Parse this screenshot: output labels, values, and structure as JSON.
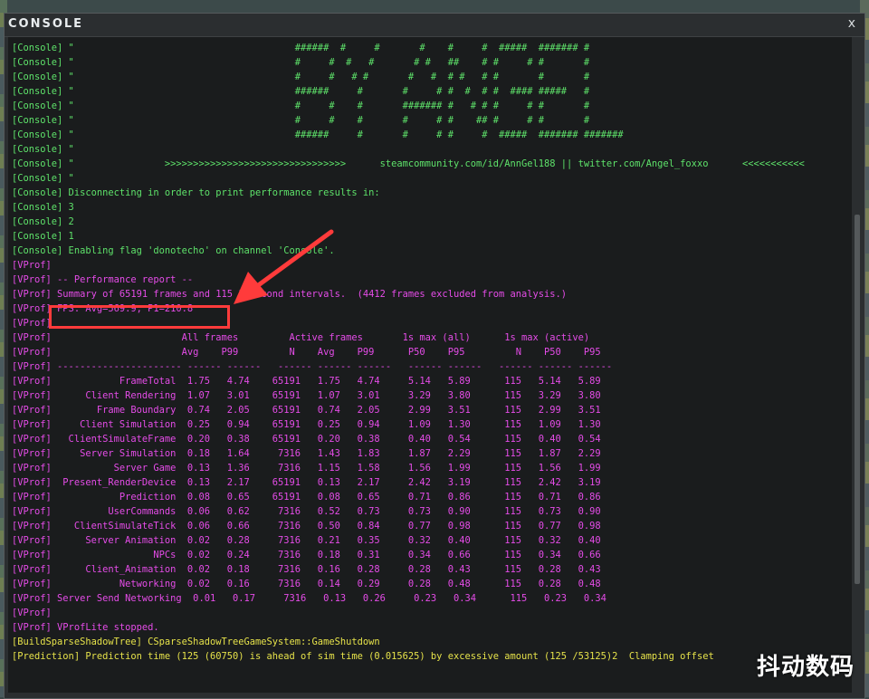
{
  "window": {
    "title": "CONSOLE",
    "close_glyph": "x"
  },
  "lines": [
    {
      "text": "[Console] \"                                       ######  #     #       #    #     #  #####  ####### #",
      "color": "green"
    },
    {
      "text": "[Console] \"                                       #     #  #   #       # #   ##    # #     # #       #",
      "color": "green"
    },
    {
      "text": "[Console] \"                                       #     #   # #       #   #  # #   # #       #       #",
      "color": "green"
    },
    {
      "text": "[Console] \"                                       ######     #       #     # #  #  # #  #### #####   #",
      "color": "green"
    },
    {
      "text": "[Console] \"                                       #     #    #       ####### #   # # #     # #       #",
      "color": "green"
    },
    {
      "text": "[Console] \"                                       #     #    #       #     # #    ## #     # #       #",
      "color": "green"
    },
    {
      "text": "[Console] \"                                       ######     #       #     # #     #  #####  ####### #######",
      "color": "green"
    },
    {
      "text": "[Console] \"",
      "color": "green"
    },
    {
      "text": "[Console] \"                >>>>>>>>>>>>>>>>>>>>>>>>>>>>>>>>      steamcommunity.com/id/AnnGel188 || twitter.com/Angel_foxxo      <<<<<<<<<<<",
      "color": "green"
    },
    {
      "text": "[Console] \"",
      "color": "green"
    },
    {
      "text": "[Console] Disconnecting in order to print performance results in:",
      "color": "green"
    },
    {
      "text": "[Console] 3",
      "color": "green"
    },
    {
      "text": "[Console] 2",
      "color": "green"
    },
    {
      "text": "[Console] 1",
      "color": "green"
    },
    {
      "text": "[Console] Enabling flag 'donotecho' on channel 'Console'.",
      "color": "green"
    },
    {
      "text": "[VProf]",
      "color": "magenta"
    },
    {
      "text": "[VProf] -- Performance report --",
      "color": "magenta"
    },
    {
      "text": "[VProf] Summary of 65191 frames and 115 1-second intervals.  (4412 frames excluded from analysis.)",
      "color": "magenta"
    },
    {
      "text": "[VProf] FPS: Avg=569.9, P1=210.8",
      "color": "magenta"
    },
    {
      "text": "[VProf]",
      "color": "magenta"
    },
    {
      "text": "[VProf]                       All frames         Active frames       1s max (all)      1s max (active)",
      "color": "magenta"
    },
    {
      "text": "[VProf]                       Avg    P99         N    Avg    P99      P50    P95         N    P50    P95",
      "color": "magenta"
    },
    {
      "text": "[VProf] ---------------------- ------ ------   ------ ------ ------   ------ ------   ------ ------ ------",
      "color": "magenta"
    },
    {
      "text": "[VProf]            FrameTotal  1.75   4.74    65191   1.75   4.74     5.14   5.89      115   5.14   5.89",
      "color": "magenta"
    },
    {
      "text": "[VProf]      Client Rendering  1.07   3.01    65191   1.07   3.01     3.29   3.80      115   3.29   3.80",
      "color": "magenta"
    },
    {
      "text": "[VProf]        Frame Boundary  0.74   2.05    65191   0.74   2.05     2.99   3.51      115   2.99   3.51",
      "color": "magenta"
    },
    {
      "text": "[VProf]     Client Simulation  0.25   0.94    65191   0.25   0.94     1.09   1.30      115   1.09   1.30",
      "color": "magenta"
    },
    {
      "text": "[VProf]   ClientSimulateFrame  0.20   0.38    65191   0.20   0.38     0.40   0.54      115   0.40   0.54",
      "color": "magenta"
    },
    {
      "text": "[VProf]     Server Simulation  0.18   1.64     7316   1.43   1.83     1.87   2.29      115   1.87   2.29",
      "color": "magenta"
    },
    {
      "text": "[VProf]           Server Game  0.13   1.36     7316   1.15   1.58     1.56   1.99      115   1.56   1.99",
      "color": "magenta"
    },
    {
      "text": "[VProf]  Present_RenderDevice  0.13   2.17    65191   0.13   2.17     2.42   3.19      115   2.42   3.19",
      "color": "magenta"
    },
    {
      "text": "[VProf]            Prediction  0.08   0.65    65191   0.08   0.65     0.71   0.86      115   0.71   0.86",
      "color": "magenta"
    },
    {
      "text": "[VProf]          UserCommands  0.06   0.62     7316   0.52   0.73     0.73   0.90      115   0.73   0.90",
      "color": "magenta"
    },
    {
      "text": "[VProf]    ClientSimulateTick  0.06   0.66     7316   0.50   0.84     0.77   0.98      115   0.77   0.98",
      "color": "magenta"
    },
    {
      "text": "[VProf]      Server Animation  0.02   0.28     7316   0.21   0.35     0.32   0.40      115   0.32   0.40",
      "color": "magenta"
    },
    {
      "text": "[VProf]                  NPCs  0.02   0.24     7316   0.18   0.31     0.34   0.66      115   0.34   0.66",
      "color": "magenta"
    },
    {
      "text": "[VProf]      Client_Animation  0.02   0.18     7316   0.16   0.28     0.28   0.43      115   0.28   0.43",
      "color": "magenta"
    },
    {
      "text": "[VProf]            Networking  0.02   0.16     7316   0.14   0.29     0.28   0.48      115   0.28   0.48",
      "color": "magenta"
    },
    {
      "text": "[VProf] Server Send Networking  0.01   0.17     7316   0.13   0.26     0.23   0.34      115   0.23   0.34",
      "color": "magenta"
    },
    {
      "text": "[VProf]",
      "color": "magenta"
    },
    {
      "text": "[VProf] VProfLite stopped.",
      "color": "magenta"
    },
    {
      "text": "[BuildSparseShadowTree] CSparseShadowTreeGameSystem::GameShutdown",
      "color": "yellow"
    },
    {
      "text": "[Prediction] Prediction time (125 (60750) is ahead of sim time (0.015625) by excessive amount (125 /53125)2  Clamping offset",
      "color": "yellow"
    }
  ],
  "annotation": {
    "highlight_label": "FPS: Avg=569.9, P1=210.8",
    "stroke_color": "#ff3b3b"
  },
  "watermark": {
    "text": "抖动数码"
  },
  "colors": {
    "green": "#5ee26a",
    "magenta": "#e54ce8",
    "yellow": "#e6e24a",
    "background": "#1a1c1d"
  }
}
